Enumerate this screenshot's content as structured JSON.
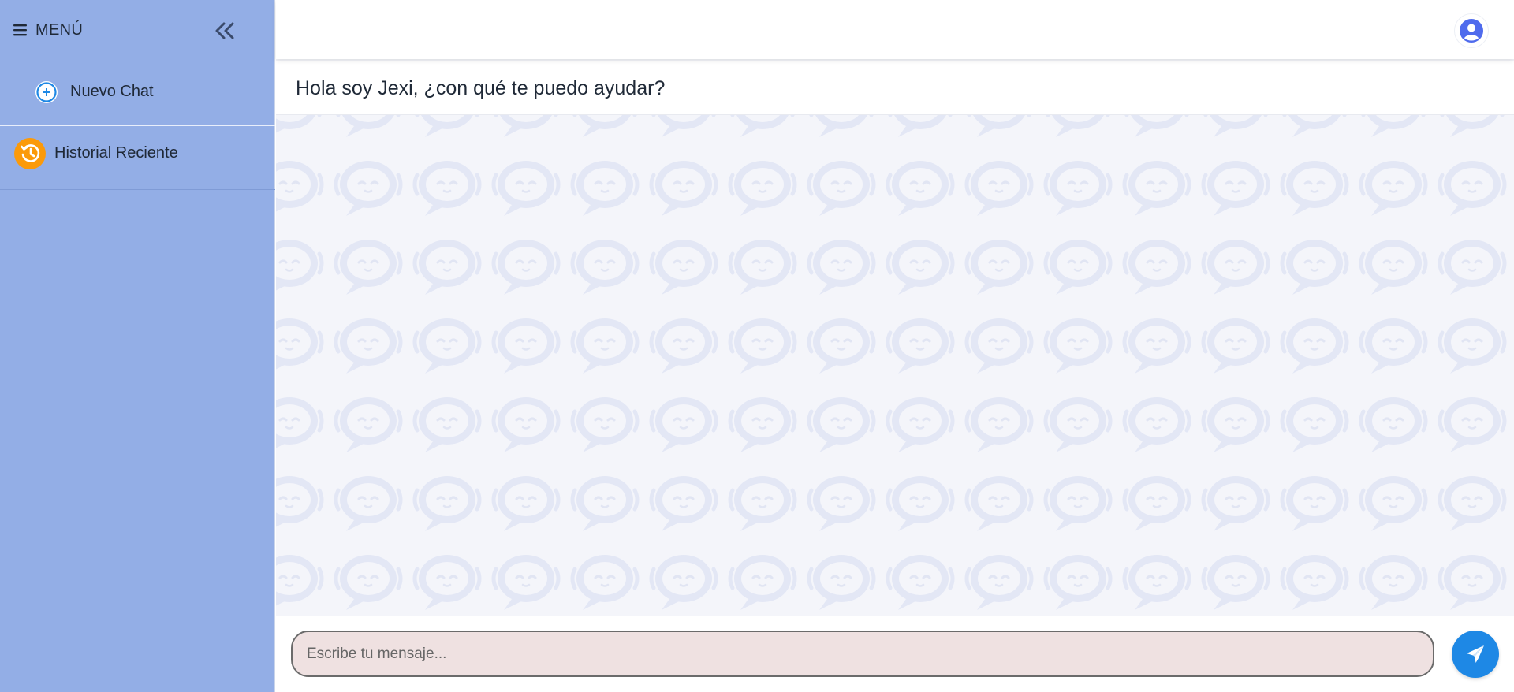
{
  "sidebar": {
    "menu_label": "MENÚ",
    "menu_icon": "hamburger-icon",
    "collapse_icon": "double-chevron-left-icon",
    "items": [
      {
        "label": "Nuevo Chat",
        "icon": "plus-circle-icon"
      },
      {
        "label": "Historial Reciente",
        "icon": "history-icon"
      }
    ]
  },
  "header": {
    "avatar_icon": "user-circle-icon"
  },
  "chat": {
    "greeting": "Hola soy Jexi, ¿con qué te puedo ayudar?",
    "background_icon": "robot-chat-bubble-icon"
  },
  "composer": {
    "placeholder": "Escribe tu mensaje...",
    "value": "",
    "send_icon": "paper-plane-icon"
  },
  "colors": {
    "sidebar_bg": "#93aee6",
    "accent_blue": "#1e88e5",
    "history_orange": "#fb9a0a",
    "avatar_indigo": "#4f6bed",
    "input_bg": "#efe1e1"
  }
}
